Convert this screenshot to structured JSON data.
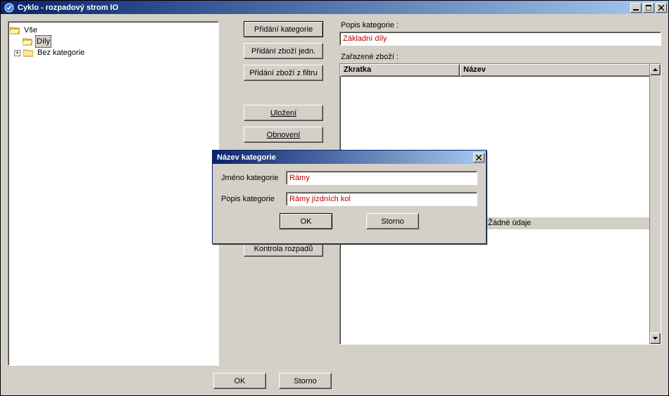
{
  "window": {
    "title": "Cyklo - rozpadový strom IO"
  },
  "tree": {
    "root": "Vše",
    "item1": "Díly",
    "item2": "Bez kategorie"
  },
  "buttons": {
    "add_category": "Přidání kategorie",
    "add_goods_single": "Přidání zboží jedn.",
    "add_goods_filter": "Přidání zboží z filtru",
    "save": "Uložení",
    "refresh": "Obnovení",
    "check": "Kontrola rozpadů",
    "ok": "OK",
    "cancel": "Storno"
  },
  "right": {
    "desc_label": "Popis kategorie :",
    "desc_value": "Základní díly",
    "goods_label": "Zařazené zboží :",
    "col_short": "Zkratka",
    "col_name": "Název",
    "empty": "Žádné údaje"
  },
  "modal": {
    "title": "Název kategorie",
    "name_label": "Jméno kategorie",
    "name_value": "Rámy",
    "desc_label": "Popis kategorie",
    "desc_value": "Rámy jízdních kol",
    "ok": "OK",
    "cancel": "Storno"
  }
}
